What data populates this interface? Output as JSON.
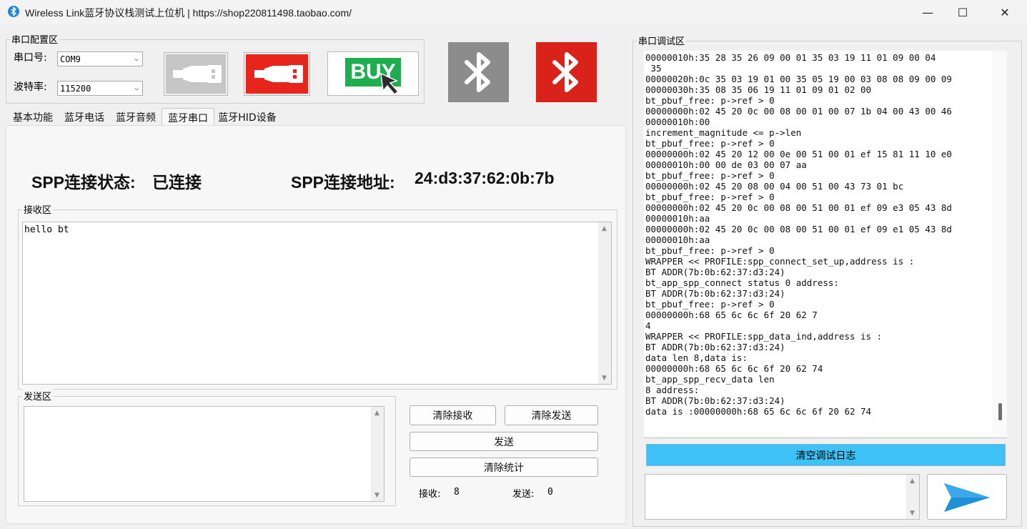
{
  "window": {
    "title": "Wireless Link蓝牙协议栈测试上位机 | https://shop220811498.taobao.com/",
    "minimize": "—",
    "maximize": "☐",
    "close": "✕"
  },
  "serial_config": {
    "group_title": "串口配置区",
    "port_label": "串口号:",
    "port_value": "COM9",
    "baud_label": "波特率:",
    "baud_value": "115200"
  },
  "toolbar": {
    "buy_label": "BUY",
    "usb_disconnected_icon": "usb-gray-icon",
    "usb_connected_icon": "usb-red-icon",
    "bt_gray_icon": "bluetooth-gray-icon",
    "bt_red_icon": "bluetooth-red-icon",
    "colors": {
      "gray": "#8c8c8c",
      "red": "#d9231a",
      "green": "#1fae4f"
    }
  },
  "tabs": [
    {
      "label": "基本功能",
      "active": false
    },
    {
      "label": "蓝牙电话",
      "active": false
    },
    {
      "label": "蓝牙音频",
      "active": false
    },
    {
      "label": "蓝牙串口",
      "active": true
    },
    {
      "label": "蓝牙HID设备",
      "active": false
    }
  ],
  "spp": {
    "status_label": "SPP连接状态:",
    "status_value": "已连接",
    "address_label": "SPP连接地址:",
    "address_value": "24:d3:37:62:0b:7b"
  },
  "receive": {
    "group_title": "接收区",
    "content": "hello bt"
  },
  "send": {
    "group_title": "发送区",
    "content": ""
  },
  "buttons": {
    "clear_receive": "清除接收",
    "clear_send": "清除发送",
    "send": "发送",
    "clear_stats": "清除统计"
  },
  "stats": {
    "recv_label": "接收:",
    "recv_value": "8",
    "send_label": "发送:",
    "send_value": "0"
  },
  "debug": {
    "group_title": "串口调试区",
    "lines": [
      "00000010h:35 28 35 26 09 00 01 35 03 19 11 01 09 00 04",
      " 35",
      "00000020h:0c 35 03 19 01 00 35 05 19 00 03 08 08 09 00 09",
      "00000030h:35 08 35 06 19 11 01 09 01 02 00",
      "bt_pbuf_free: p->ref > 0",
      "00000000h:02 45 20 0c 00 08 00 01 00 07 1b 04 00 43 00 46",
      "00000010h:00",
      "increment_magnitude <= p->len",
      "bt_pbuf_free: p->ref > 0",
      "00000000h:02 45 20 12 00 0e 00 51 00 01 ef 15 81 11 10 e0",
      "00000010h:00 00 de 03 00 07 aa",
      "bt_pbuf_free: p->ref > 0",
      "00000000h:02 45 20 08 00 04 00 51 00 43 73 01 bc",
      "bt_pbuf_free: p->ref > 0",
      "00000000h:02 45 20 0c 00 08 00 51 00 01 ef 09 e3 05 43 8d",
      "00000010h:aa",
      "00000000h:02 45 20 0c 00 08 00 51 00 01 ef 09 e1 05 43 8d",
      "00000010h:aa",
      "bt_pbuf_free: p->ref > 0",
      "WRAPPER << PROFILE:spp_connect_set_up,address is :",
      "BT ADDR(7b:0b:62:37:d3:24)",
      "bt_app_spp_connect status 0 address:",
      "BT ADDR(7b:0b:62:37:d3:24)",
      "bt_pbuf_free: p->ref > 0",
      "00000000h:68 65 6c 6c 6f 20 62 7",
      "4",
      "WRAPPER << PROFILE:spp_data_ind,address is :",
      "BT ADDR(7b:0b:62:37:d3:24)",
      "data len 8,data is:",
      "00000000h:68 65 6c 6c 6f 20 62 74",
      "bt_app_spp_recv_data len",
      "8 address:",
      "BT ADDR(7b:0b:62:37:d3:24)",
      "data is :00000000h:68 65 6c 6c 6f 20 62 74"
    ],
    "clear_log_label": "清空调试日志",
    "clear_log_color": "#3cc2f7",
    "input_value": "",
    "send_icon": "send-arrow-icon"
  }
}
